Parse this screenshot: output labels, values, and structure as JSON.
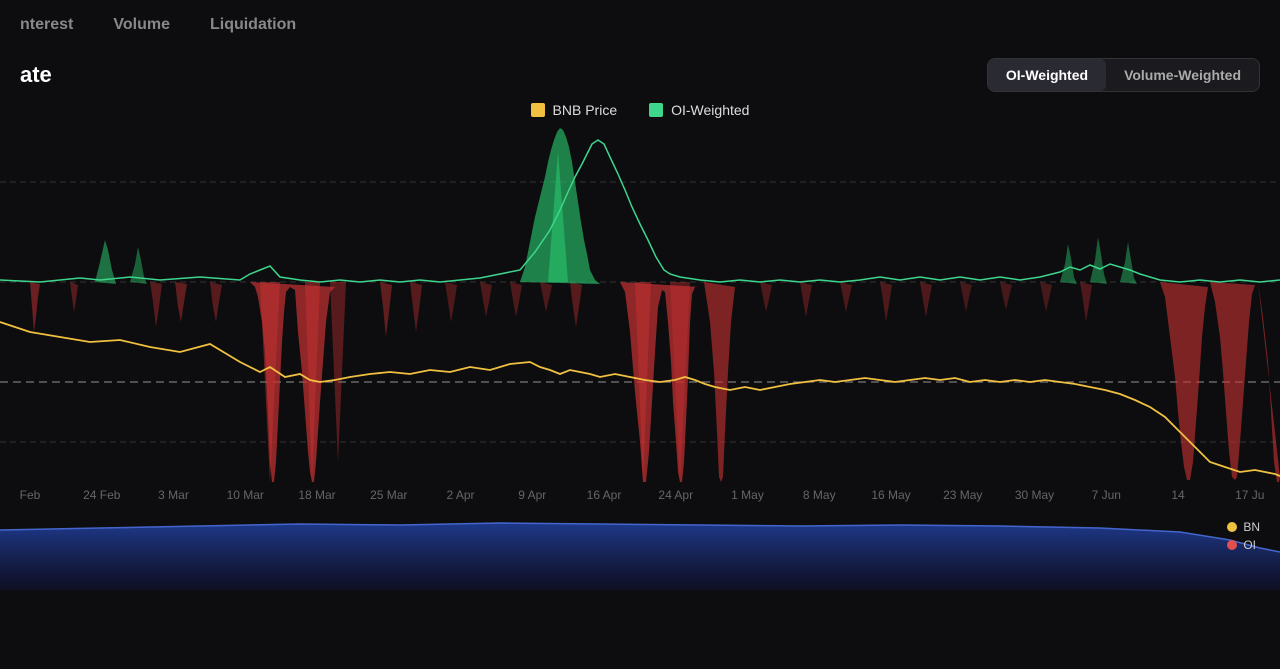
{
  "nav": {
    "items": [
      {
        "label": "Open Interest",
        "active": false
      },
      {
        "label": "Volume",
        "active": false
      },
      {
        "label": "Liquidation",
        "active": false
      }
    ]
  },
  "chart": {
    "title": "ate",
    "weight_buttons": [
      {
        "label": "OI-Weighted",
        "active": true
      },
      {
        "label": "Volume-Weighted",
        "active": false
      }
    ],
    "legend": [
      {
        "label": "BNB Price",
        "color": "#f0c040"
      },
      {
        "label": "OI-Weighted",
        "color": "#3dd68c"
      }
    ],
    "x_axis_labels": [
      "Feb",
      "24 Feb",
      "3 Mar",
      "10 Mar",
      "18 Mar",
      "25 Mar",
      "2 Apr",
      "9 Apr",
      "16 Apr",
      "24 Apr",
      "1 May",
      "8 May",
      "16 May",
      "23 May",
      "30 May",
      "7 Jun",
      "14",
      "17 Ju"
    ],
    "bottom_legend": [
      {
        "label": "BN",
        "color": "#f0c040"
      },
      {
        "label": "OI",
        "color": "#e05050"
      }
    ]
  }
}
